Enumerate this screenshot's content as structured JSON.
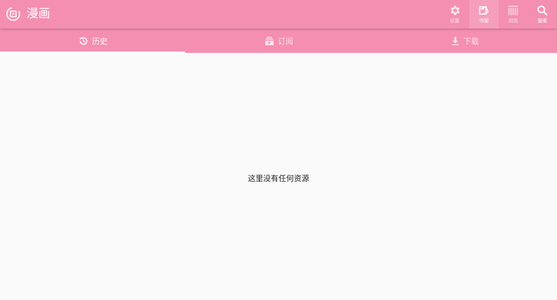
{
  "app": {
    "title": "漫画",
    "brand_color": "#f48fb1",
    "logo_icon": "manga-logo-icon"
  },
  "toolbar": {
    "actions": [
      {
        "label": "设置",
        "icon": "gear-icon",
        "active": false
      },
      {
        "label": "书架",
        "icon": "bookshelf-icon",
        "active": true
      },
      {
        "label": "浏览",
        "icon": "browse-grid-icon",
        "active": false
      },
      {
        "label": "搜索",
        "icon": "search-icon",
        "active": false
      }
    ]
  },
  "tabs": [
    {
      "label": "历史",
      "icon": "history-icon",
      "active": true
    },
    {
      "label": "订阅",
      "icon": "subscribe-icon",
      "active": false
    },
    {
      "label": "下载",
      "icon": "download-icon",
      "active": false
    }
  ],
  "content": {
    "empty_message": "这里没有任何资源"
  }
}
